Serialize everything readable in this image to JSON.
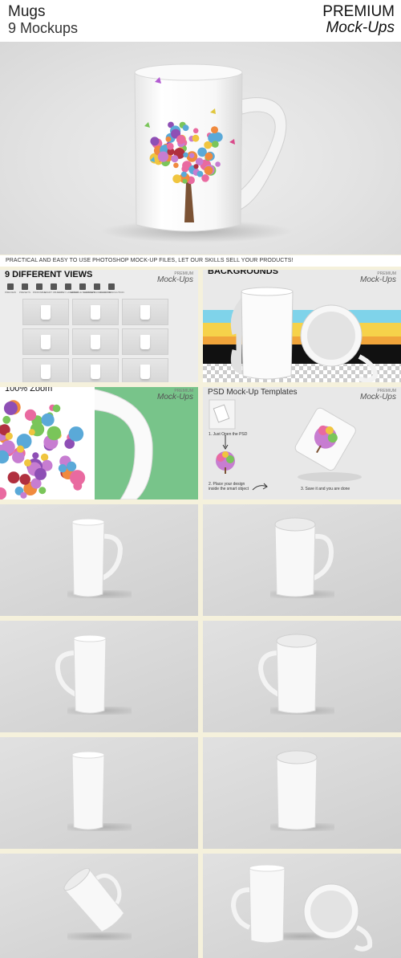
{
  "header": {
    "title": "Mugs",
    "subtitle": "9 Mockups",
    "premium": "PREMIUM",
    "mockups_script": "Mock-Ups"
  },
  "tagline": "PRACTICAL AND EASY TO USE PHOTOSHOP MOCK-UP FILES, LET OUR SKILLS SELL YOUR PRODUCTS!",
  "panels": {
    "views": {
      "title": "9 DIFFERENT VIEWS",
      "logo": {
        "small": "PREMIUM",
        "script": "Mock-Ups"
      },
      "icons": [
        "PREVIEW",
        "PRESETS",
        "PRINTABLE",
        "SMART OBJECTS",
        "FULLY LAYERED",
        "EDITABLE SHADOWS",
        "CHANGE BACKGROUND",
        "HIGHLY RESOLUTION"
      ]
    },
    "backgrounds": {
      "title": "BACKGROUNDS",
      "logo": {
        "small": "PREMIUM",
        "script": "Mock-Ups"
      },
      "stripe_colors": [
        "#7fd3ea",
        "#f6d24a",
        "#f0a43a",
        "#111111"
      ]
    },
    "zoom": {
      "title": "100% Zoom",
      "logo": {
        "small": "PREMIUM",
        "script": "Mock-Ups"
      },
      "bg_color": "#78c48a"
    },
    "templates": {
      "title": "PSD Mock-Up Templates",
      "logo": {
        "small": "PREMIUM",
        "script": "Mock-Ups"
      },
      "step1": "1. Just Open the PSD",
      "step2": "2. Place your design inside the smart object",
      "step3": "3. Save it and you are done"
    }
  },
  "colors": {
    "accent_cream": "#f5f1dc",
    "mug_white": "#ffffff"
  }
}
